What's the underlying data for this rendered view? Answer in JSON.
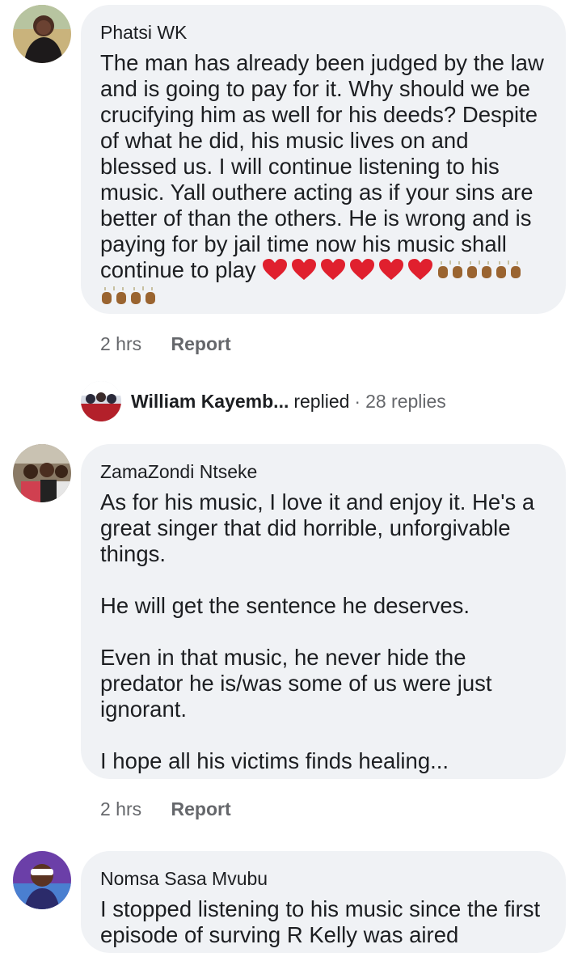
{
  "comments": [
    {
      "author": "Phatsi WK",
      "text": "The man has already been judged by the law and is going to pay for it. Why should we be crucifying him as well for his deeds? Despite of what he did, his music lives on and blessed us. I will continue listening to his music. Yall outhere acting as if your sins are better of than the others. He is wrong and is paying for by jail time now his music shall continue to play",
      "emojis": [
        "red-heart",
        "red-heart",
        "red-heart",
        "red-heart",
        "red-heart",
        "red-heart",
        "raising-hands",
        "raising-hands",
        "raising-hands",
        "raising-hands",
        "raising-hands"
      ],
      "time": "2 hrs",
      "report_label": "Report"
    },
    {
      "author": "ZamaZondi Ntseke",
      "text": "As for his music, I love it and enjoy it. He's a great singer that did horrible, unforgivable things.\n\nHe will get the sentence he deserves.\n\nEven in that music, he never hide the predator he is/was some of us were just ignorant.\n\nI hope all his victims finds healing...",
      "time": "2 hrs",
      "report_label": "Report"
    },
    {
      "author": "Nomsa Sasa Mvubu",
      "text": "I stopped listening to his music since the first episode of surving R Kelly was aired"
    }
  ],
  "reply_summary": {
    "name": "William Kayemb...",
    "verb": "replied",
    "separator": "·",
    "count": "28 replies"
  },
  "colors": {
    "bubble": "#f0f2f5",
    "meta": "#65676b",
    "text": "#1c1e21",
    "heart": "#e0202e",
    "hands": "#9a6430"
  }
}
